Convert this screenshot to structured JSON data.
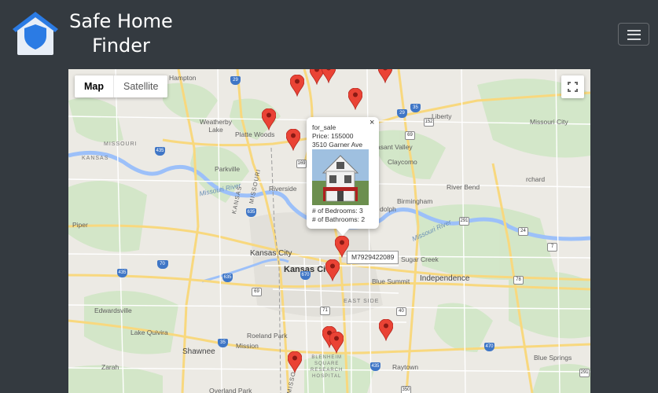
{
  "brand": {
    "line1": "Safe Home",
    "line2": "Finder"
  },
  "colors": {
    "navbar": "#343a40",
    "marker": "#ea4335",
    "logo_house": "#e8eef7",
    "logo_shield": "#2b7be4"
  },
  "map": {
    "map_type": {
      "map_label": "Map",
      "satellite_label": "Satellite",
      "selected": "Map"
    },
    "labels": {
      "hampton": "Hampton",
      "liberty": "Liberty",
      "missouri_city": "Missouri City",
      "weatherby_lake": "Weatherby\nLake",
      "platte_woods": "Platte Woods",
      "missouri_state": "MISSOURI",
      "kansas_state": "KANSAS",
      "pleasant_valley": "asant Valley",
      "parkville": "Parkville",
      "claycomo": "Claycomo",
      "riverside": "Riverside",
      "river_bend": "River Bend",
      "missouri_river": "Missouri River",
      "birmingham": "Birmingham",
      "orchard": "rchard",
      "dolph": "dolph",
      "piper": "Piper",
      "kansas_city_ks": "Kansas City",
      "kansas_city_mo": "Kansas Ci",
      "sugar_creek": "Sugar Creek",
      "blue_summit": "Blue Summit",
      "independence": "Independence",
      "edwardsville": "Edwardsville",
      "east_side": "EAST SIDE",
      "lake_quivira": "Lake Quivira",
      "roeland_park": "Roeland Park",
      "shawnee": "Shawnee",
      "mission": "Mission",
      "zarah": "Zarah",
      "blenheim": "BLENHEIM\nSQUARE\nRESEARCH\nHOSPITAL",
      "raytown": "Raytown",
      "blue_springs": "Blue Springs",
      "overland_park": "Overland Park",
      "kansas_rot": "KANSAS",
      "missouri_rot": "MISSOURI",
      "missouri_river2": "Missouri River",
      "missouri_rot2": "MISSO"
    },
    "shields": {
      "s29a": "29",
      "s35a": "35",
      "s435a": "435",
      "s152": "152",
      "s69a": "69",
      "s635": "635",
      "s169": "169",
      "s291a": "291",
      "s70a": "70",
      "s670": "670",
      "s35b": "35",
      "s70b": "70",
      "s435b": "435",
      "s71": "71",
      "s35c": "35",
      "s69b": "69",
      "s40": "40",
      "s350": "350",
      "s470": "470",
      "s24": "24",
      "s7": "7",
      "s78": "78",
      "s291b": "291"
    },
    "marker_tag": "M7929422089",
    "info_window": {
      "status": "for_sale",
      "price": "Price: 155000",
      "address": "3510 Garner Ave",
      "bedrooms": "# of Bedrooms: 3",
      "bathrooms": "# of Bathrooms: 2",
      "close_glyph": "×"
    },
    "marker_count": 14
  }
}
